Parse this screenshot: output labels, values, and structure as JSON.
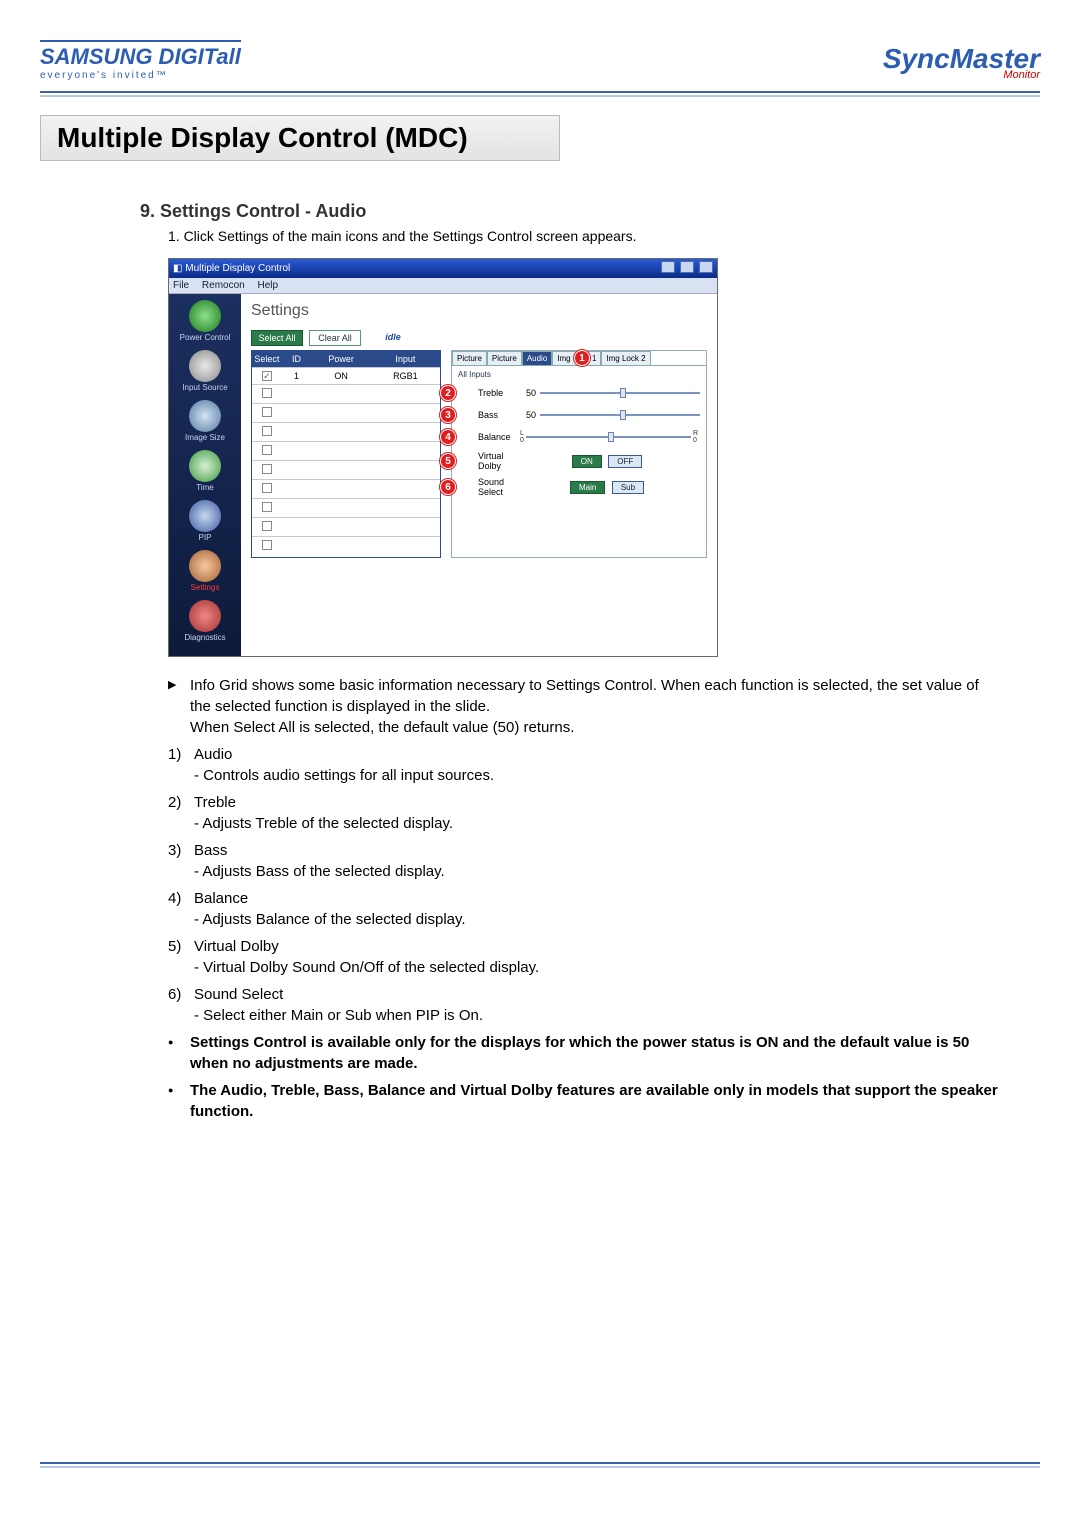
{
  "header": {
    "brand_top": "SAMSUNG DIGIT",
    "brand_all": "all",
    "brand_tag": "everyone's invited™",
    "product": "SyncMaster",
    "product_sub": "Monitor"
  },
  "page_title": "Multiple Display Control (MDC)",
  "section_title": "9. Settings Control - Audio",
  "intro": "1.  Click Settings of the main icons and the Settings Control screen appears.",
  "screenshot": {
    "window_title": "Multiple Display Control",
    "menu": [
      "File",
      "Remocon",
      "Help"
    ],
    "sidebar": [
      {
        "label": "Power Control",
        "icon": "power-icon"
      },
      {
        "label": "Input Source",
        "icon": "input-icon"
      },
      {
        "label": "Image Size",
        "icon": "image-size-icon"
      },
      {
        "label": "Time",
        "icon": "time-icon"
      },
      {
        "label": "PIP",
        "icon": "pip-icon"
      },
      {
        "label": "Settings",
        "icon": "settings-icon",
        "active": true
      },
      {
        "label": "Diagnostics",
        "icon": "diagnostics-icon"
      }
    ],
    "main_title": "Settings",
    "toolbar": {
      "select_all": "Select All",
      "clear_all": "Clear All",
      "idle": "idle"
    },
    "grid": {
      "headers": [
        "Select",
        "ID",
        "Power",
        "Input"
      ],
      "rows": [
        {
          "checked": true,
          "id": "1",
          "power": "ON",
          "input": "RGB1"
        }
      ],
      "blank_rows": 9
    },
    "panel": {
      "tabs": [
        "Picture",
        "Picture",
        "Audio",
        "Img Lock 1",
        "Img Lock 2"
      ],
      "active_tab": 2,
      "subtab": "All Inputs",
      "badge1": "1",
      "rows": [
        {
          "badge": "2",
          "label": "Treble",
          "value": "50"
        },
        {
          "badge": "3",
          "label": "Bass",
          "value": "50"
        },
        {
          "badge": "4",
          "label": "Balance",
          "left": "L",
          "right": "R",
          "value": "0"
        }
      ],
      "dolby": {
        "badge": "5",
        "label": "Virtual Dolby",
        "on": "ON",
        "off": "OFF"
      },
      "sound": {
        "badge": "6",
        "label": "Sound Select",
        "main": "Main",
        "sub": "Sub"
      }
    }
  },
  "notes": {
    "caret": "Info Grid shows some basic information necessary to Settings Control. When each function is selected, the set value of the selected function is displayed in the slide.\nWhen Select All is selected, the default value (50) returns.",
    "items": [
      {
        "n": "1)",
        "t": "Audio",
        "sub": "- Controls audio settings for all input sources."
      },
      {
        "n": "2)",
        "t": "Treble",
        "sub": "- Adjusts Treble of the selected display."
      },
      {
        "n": "3)",
        "t": "Bass",
        "sub": "- Adjusts Bass of the selected display."
      },
      {
        "n": "4)",
        "t": "Balance",
        "sub": "- Adjusts Balance of the selected display."
      },
      {
        "n": "5)",
        "t": "Virtual Dolby",
        "sub": "- Virtual Dolby Sound On/Off of the selected display."
      },
      {
        "n": "6)",
        "t": "Sound Select",
        "sub": "- Select either Main or Sub when PIP is On."
      }
    ],
    "bullets": [
      "Settings Control is available only for the displays for which the power status is ON and the default value is 50 when no adjustments are made.",
      "The Audio, Treble, Bass, Balance and Virtual Dolby features are available only in models that support the speaker function."
    ]
  }
}
